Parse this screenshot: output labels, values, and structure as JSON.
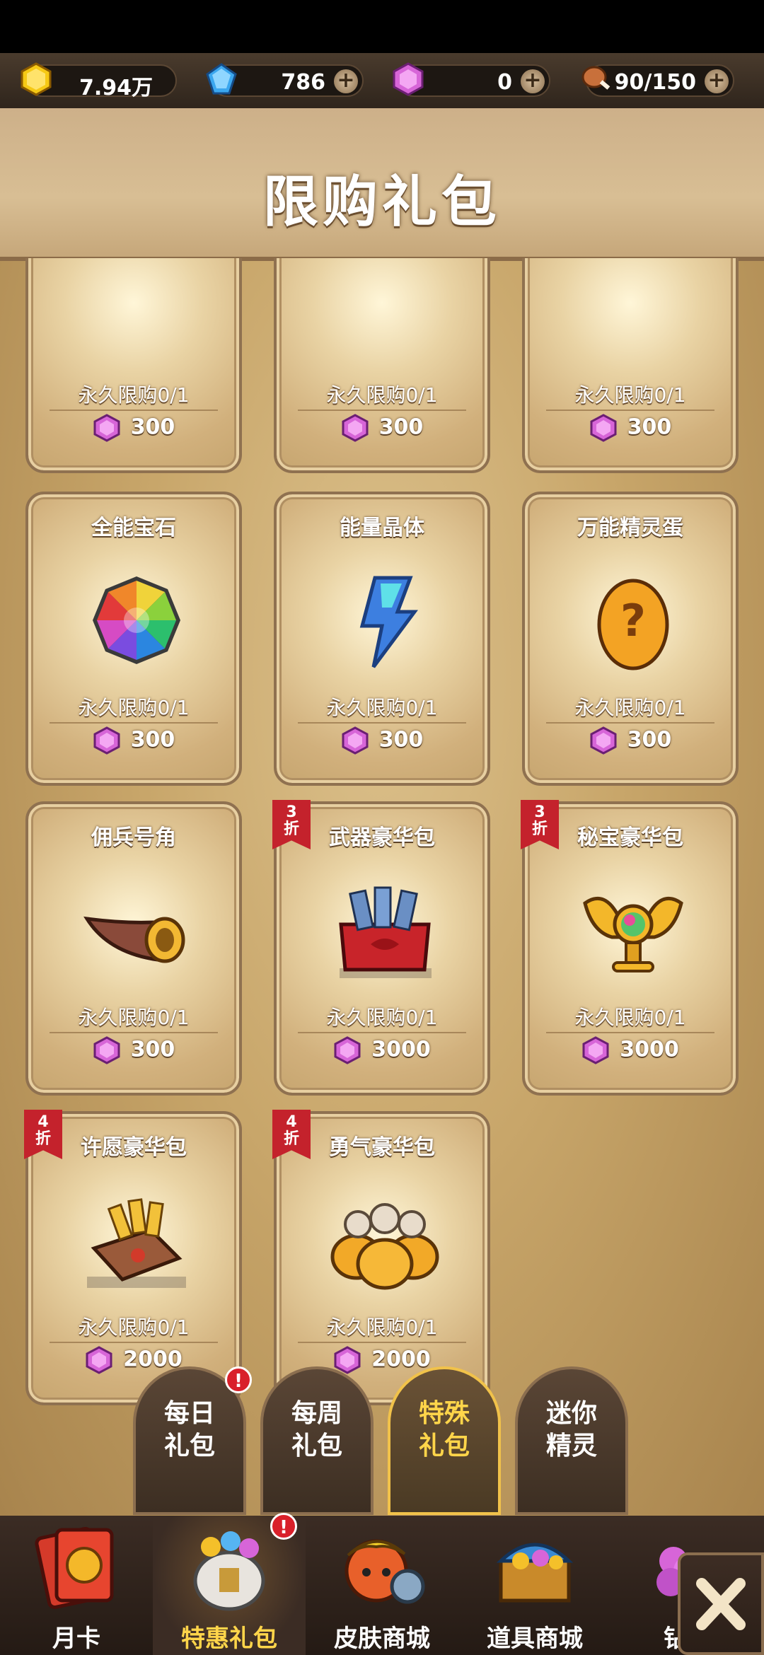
{
  "resources": [
    {
      "name": "gold",
      "value": "7.94万",
      "has_plus": false
    },
    {
      "name": "diamond",
      "value": "786",
      "has_plus": true
    },
    {
      "name": "purple_gem",
      "value": "0",
      "has_plus": true
    },
    {
      "name": "stamina",
      "value": "90/150",
      "has_plus": true
    }
  ],
  "header": {
    "title": "限购礼包"
  },
  "cards": [
    {
      "name": "",
      "limit": "永久限购0/1",
      "price": "300",
      "badge": "",
      "icon": "partial-item"
    },
    {
      "name": "",
      "limit": "永久限购0/1",
      "price": "300",
      "badge": "",
      "icon": "partial-item"
    },
    {
      "name": "",
      "limit": "永久限购0/1",
      "price": "300",
      "badge": "",
      "icon": "partial-item"
    },
    {
      "name": "全能宝石",
      "limit": "永久限购0/1",
      "price": "300",
      "badge": "",
      "icon": "rainbow-gem-icon"
    },
    {
      "name": "能量晶体",
      "limit": "永久限购0/1",
      "price": "300",
      "badge": "",
      "icon": "energy-crystal-icon"
    },
    {
      "name": "万能精灵蛋",
      "limit": "永久限购0/1",
      "price": "300",
      "badge": "",
      "icon": "spirit-egg-icon"
    },
    {
      "name": "佣兵号角",
      "limit": "永久限购0/1",
      "price": "300",
      "badge": "",
      "icon": "horn-icon"
    },
    {
      "name": "武器豪华包",
      "limit": "永久限购0/1",
      "price": "3000",
      "badge": "3\n折",
      "icon": "weapon-pack-icon"
    },
    {
      "name": "秘宝豪华包",
      "limit": "永久限购0/1",
      "price": "3000",
      "badge": "3\n折",
      "icon": "treasure-pack-icon"
    },
    {
      "name": "许愿豪华包",
      "limit": "永久限购0/1",
      "price": "2000",
      "badge": "4\n折",
      "icon": "wish-pack-icon"
    },
    {
      "name": "勇气豪华包",
      "limit": "永久限购0/1",
      "price": "2000",
      "badge": "4\n折",
      "icon": "courage-pack-icon"
    }
  ],
  "tabs": [
    {
      "label": "每日\n礼包",
      "active": false,
      "alert": "!"
    },
    {
      "label": "每周\n礼包",
      "active": false,
      "alert": ""
    },
    {
      "label": "特殊\n礼包",
      "active": true,
      "alert": ""
    },
    {
      "label": "迷你\n精灵",
      "active": false,
      "alert": ""
    }
  ],
  "bottom_nav": [
    {
      "label": "月卡",
      "active": false,
      "alert": ""
    },
    {
      "label": "特惠礼包",
      "active": true,
      "alert": "!"
    },
    {
      "label": "皮肤商城",
      "active": false,
      "alert": ""
    },
    {
      "label": "道具商城",
      "active": false,
      "alert": ""
    },
    {
      "label": "钻石",
      "active": false,
      "alert": ""
    }
  ],
  "close_label": "✕",
  "colors": {
    "accent": "#ffd54a",
    "badge": "#c4222c",
    "gem": "#e47be8"
  }
}
